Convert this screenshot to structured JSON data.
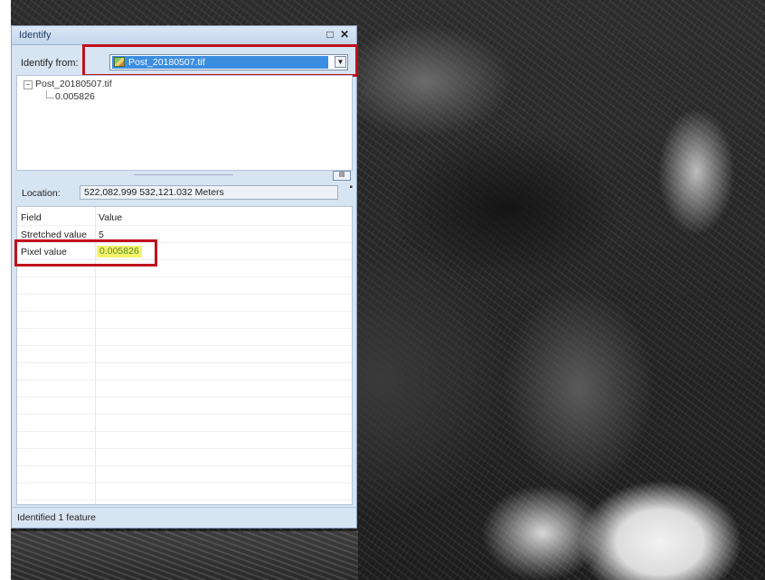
{
  "window": {
    "title": "Identify",
    "restore_glyph": "□",
    "close_glyph": "✕"
  },
  "identify_from": {
    "label": "Identify from:",
    "selected": "Post_20180507.tif",
    "icon": "raster-layer-icon",
    "dropdown_glyph": "▼"
  },
  "tree": {
    "expander_glyph": "−",
    "root": "Post_20180507.tif",
    "child": "0.005826"
  },
  "splitter": {
    "button_glyph": "▤"
  },
  "location": {
    "label": "Location:",
    "value": "522,082.999  532,121.032 Meters",
    "pin_glyph": "▪"
  },
  "table": {
    "headers": {
      "field": "Field",
      "value": "Value"
    },
    "rows": [
      {
        "field": "Stretched value",
        "value": "5"
      },
      {
        "field": "Pixel value",
        "value": "0.005826"
      }
    ]
  },
  "status": {
    "text": "Identified 1 feature"
  },
  "colors": {
    "highlight_red": "#c0101c",
    "selection_blue": "#3b8de0",
    "value_highlight": "#f6f36a"
  }
}
